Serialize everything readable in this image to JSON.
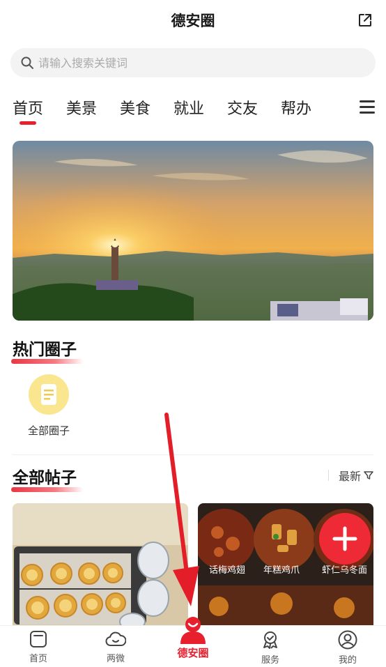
{
  "header": {
    "title": "德安圈"
  },
  "search": {
    "placeholder": "请输入搜索关键词"
  },
  "tabs": [
    {
      "label": "首页"
    },
    {
      "label": "美景"
    },
    {
      "label": "美食"
    },
    {
      "label": "就业"
    },
    {
      "label": "交友"
    },
    {
      "label": "帮办"
    }
  ],
  "hot_circles": {
    "title": "热门圈子",
    "items": [
      {
        "label": "全部圈子"
      }
    ]
  },
  "posts": {
    "title": "全部帖子",
    "sort_label": "最新",
    "food_labels": [
      "话梅鸡翅",
      "年糕鸡爪",
      "虾仁乌冬面"
    ]
  },
  "tabbar": [
    {
      "label": "首页",
      "icon": "home-icon"
    },
    {
      "label": "两微",
      "icon": "cloud-icon"
    },
    {
      "label": "德安圈",
      "icon": "brand-icon"
    },
    {
      "label": "服务",
      "icon": "badge-icon"
    },
    {
      "label": "我的",
      "icon": "user-icon"
    }
  ],
  "colors": {
    "accent": "#e8202e",
    "circle_icon_bg": "#fbe690"
  }
}
